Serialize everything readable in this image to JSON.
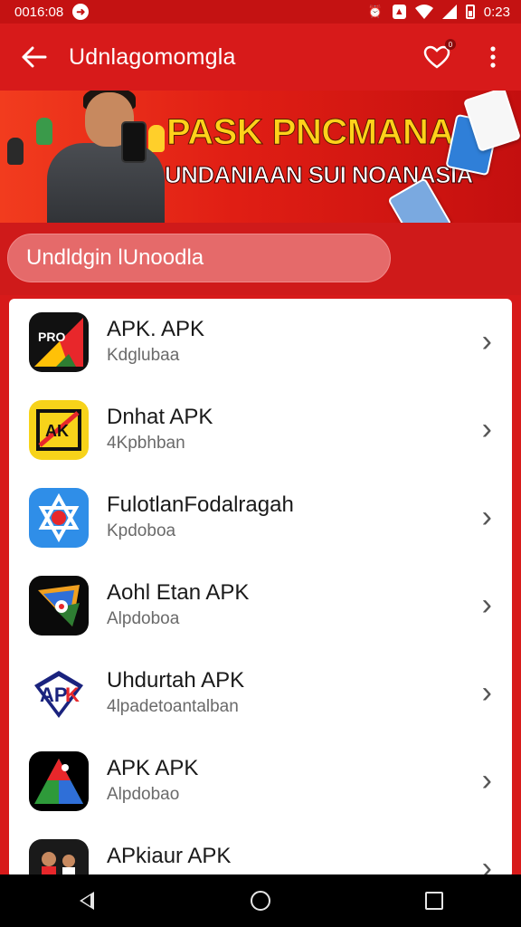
{
  "status_bar": {
    "time_left": "0016:08",
    "time_right": "0:23",
    "icons": [
      "notification-icon",
      "alarm-icon",
      "app-notification-icon",
      "wifi-icon",
      "signal-icon",
      "battery-icon"
    ]
  },
  "app_bar": {
    "title": "Udnlagomomgla",
    "back_icon": "arrow-left-icon",
    "heart_icon": "heart-icon",
    "more_icon": "more-vertical-icon",
    "badge": "0"
  },
  "banner": {
    "title": "PASK PNCMANAN",
    "subtitle": "UNDANIAAN SUI NOANASIA"
  },
  "section": {
    "label": "Undldgin lUnoodla"
  },
  "apps": [
    {
      "title": "APK. APK",
      "subtitle": "Kdglubaa",
      "icon_colors": [
        "#111111",
        "#e8272b",
        "#ffc107",
        "#2e7d32"
      ]
    },
    {
      "title": "Dnhat APK",
      "subtitle": "4Kpbhban",
      "icon_colors": [
        "#f7d31a",
        "#111111",
        "#e8272b"
      ]
    },
    {
      "title": "FulotlanFodalragah",
      "subtitle": "Kpdoboa",
      "icon_colors": [
        "#2f8ee8",
        "#ffffff",
        "#e8272b"
      ]
    },
    {
      "title": "Aohl Etan APK",
      "subtitle": "Alpdoboa",
      "icon_colors": [
        "#0a0a0a",
        "#f0a020",
        "#2f6fd8",
        "#2e7d32"
      ]
    },
    {
      "title": "Uhdurtah APK",
      "subtitle": "4lpadetoantalban",
      "icon_colors": [
        "#ffffff",
        "#1a237e",
        "#e8272b"
      ]
    },
    {
      "title": "APK APK",
      "subtitle": "Alpdobao",
      "icon_colors": [
        "#000000",
        "#e8272b",
        "#2e9a3a",
        "#2f6fd8"
      ]
    },
    {
      "title": "APkiaur APK",
      "subtitle": "",
      "icon_colors": [
        "#1a1a1a",
        "#e8272b"
      ]
    }
  ],
  "nav_bar": {
    "icons": [
      "back-triangle-icon",
      "home-circle-icon",
      "recents-square-icon"
    ]
  }
}
